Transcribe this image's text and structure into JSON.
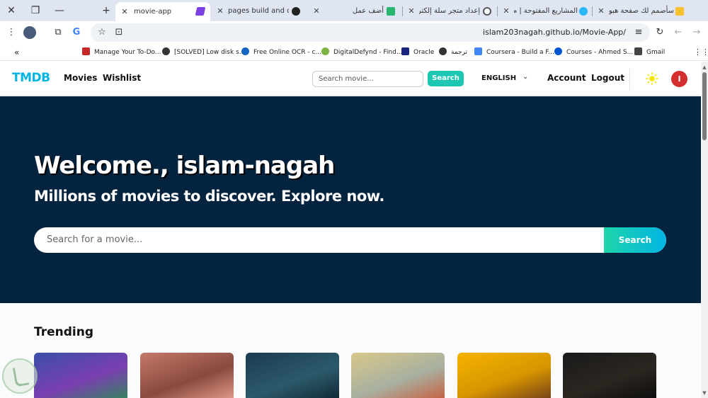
{
  "browser": {
    "tabs": [
      {
        "title": "movie-app",
        "active": true
      },
      {
        "title": "pages build and dep"
      },
      {
        "title": "أضف عمل"
      },
      {
        "title": "إعداد متجر سلة إلكترو"
      },
      {
        "title": "المشاريع المفتوحة | م"
      },
      {
        "title": "سأصمم لك صفحة هبو"
      }
    ],
    "url": "islam203nagah.github.io/Movie-App/",
    "new_tab_symbol": "+",
    "bookmarks": [
      {
        "label": "Manage Your To-Do...",
        "color": "#c62828"
      },
      {
        "label": "[SOLVED] Low disk s...",
        "color": "#333333"
      },
      {
        "label": "Free Online OCR - c...",
        "color": "#1565c0"
      },
      {
        "label": "DigitalDefynd - Find...",
        "color": "#7cb342"
      },
      {
        "label": "Oracle",
        "color": "#1a237e"
      },
      {
        "label": "ترجمة",
        "color": "#333333"
      },
      {
        "label": "Coursera - Build a F...",
        "color": "#4285f4"
      },
      {
        "label": "Courses - Ahmed S...",
        "color": "#0056d2"
      },
      {
        "label": "Gmail",
        "color": "#444444"
      }
    ]
  },
  "app": {
    "logo": "TMDB",
    "nav_links": [
      "Movies",
      "Wishlist"
    ],
    "search_placeholder": "Search movie...",
    "search_button": "Search",
    "language": "ENGLISH",
    "account": "Account",
    "logout": "Logout",
    "avatar_letter": "I"
  },
  "hero": {
    "title": "Welcome., islam-nagah",
    "subtitle": "Millions of movies to discover. Explore now.",
    "search_placeholder": "Search for a movie...",
    "search_button": "Search"
  },
  "trending": {
    "title": "Trending",
    "posters": [
      {
        "name": "poster-1",
        "colors": [
          "#3a4fa8",
          "#7a3fb0",
          "#2e8b57"
        ]
      },
      {
        "name": "poster-2",
        "colors": [
          "#c47a6a",
          "#8a4a3f",
          "#e8a090"
        ]
      },
      {
        "name": "poster-3",
        "colors": [
          "#1b3a4f",
          "#2c5a6b",
          "#0f2530"
        ]
      },
      {
        "name": "poster-4",
        "colors": [
          "#d8c88a",
          "#a8b0a0",
          "#c95a3a"
        ]
      },
      {
        "name": "poster-5",
        "colors": [
          "#f5b400",
          "#d89500",
          "#6b3a1a"
        ]
      },
      {
        "name": "poster-6",
        "colors": [
          "#1a1a1a",
          "#2b2620",
          "#0b0b0b"
        ]
      }
    ]
  },
  "colors": {
    "brand": "#01b4e4",
    "accent": "#1ec6b4",
    "hero_bg": "#04233e",
    "avatar": "#d32f2f"
  }
}
